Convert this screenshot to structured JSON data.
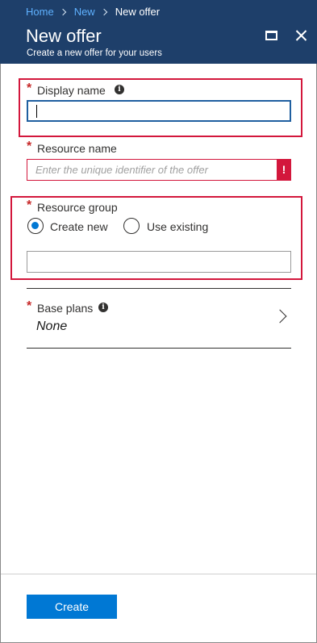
{
  "breadcrumb": {
    "items": [
      "Home",
      "New",
      "New offer"
    ]
  },
  "header": {
    "title": "New offer",
    "subtitle": "Create a new offer for your users",
    "maximize_icon": "maximize-icon",
    "close_icon": "close-icon"
  },
  "form": {
    "required_marker": "*",
    "display_name": {
      "label": "Display name",
      "value": "",
      "info_icon": "i"
    },
    "resource_name": {
      "label": "Resource name",
      "placeholder": "Enter the unique identifier of the offer",
      "value": "",
      "error_icon": "!"
    },
    "resource_group": {
      "label": "Resource group",
      "options": [
        "Create new",
        "Use existing"
      ],
      "selected": "Create new",
      "value": ""
    },
    "base_plans": {
      "label": "Base plans",
      "value": "None",
      "info_icon": "i"
    }
  },
  "footer": {
    "create_label": "Create"
  },
  "colors": {
    "header_bg": "#1e3f6a",
    "accent": "#0078d4",
    "error": "#d3173c",
    "link": "#5fb1ff"
  }
}
